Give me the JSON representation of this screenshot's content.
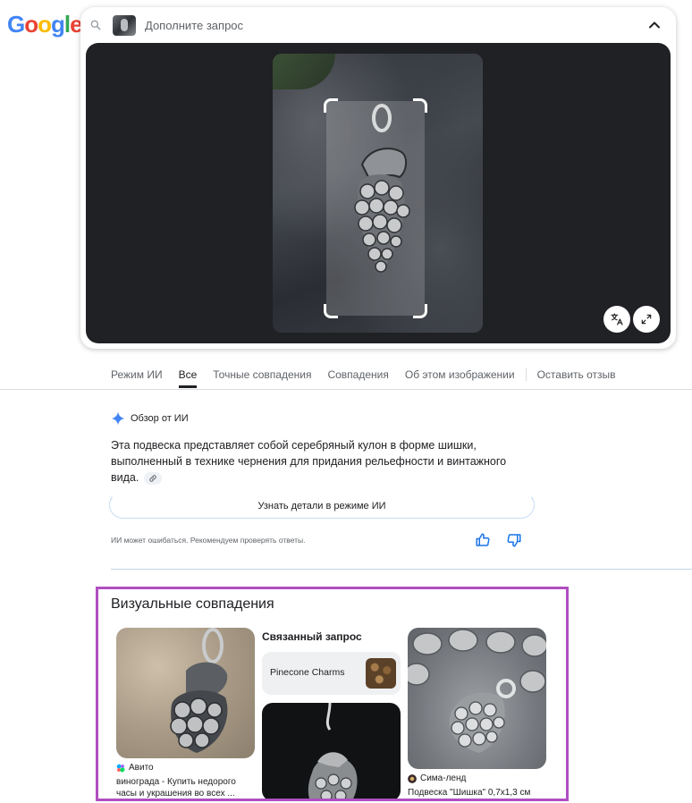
{
  "logo": {
    "letters": [
      "G",
      "o",
      "o",
      "g",
      "l",
      "e"
    ]
  },
  "search": {
    "placeholder": "Дополните запрос"
  },
  "tabs": [
    {
      "label": "Режим ИИ"
    },
    {
      "label": "Все"
    },
    {
      "label": "Точные совпадения"
    },
    {
      "label": "Совпадения"
    },
    {
      "label": "Об этом изображении"
    },
    {
      "label": "Оставить отзыв"
    }
  ],
  "ai_overview": {
    "header": "Обзор от ИИ",
    "text": "Эта подвеска представляет собой серебряный кулон в форме шишки, выполненный в технике чернения для придания рельефности и винтажного вида.",
    "more_button": "Узнать детали в режиме ИИ",
    "disclaimer": "ИИ может ошибаться. Рекомендуем проверять ответы."
  },
  "visual_matches": {
    "title": "Визуальные совпадения",
    "related_title": "Связанный запрос",
    "related_query": "Pinecone Charms",
    "results": [
      {
        "source": "Авито",
        "desc_line1": "винограда - Купить недорого",
        "desc_line2": "часы и украшения во всех ..."
      },
      {
        "source": "Сима-ленд",
        "desc_line1": "Подвеска \"Шишка\" 0,7х1,3 см"
      }
    ]
  },
  "colors": {
    "google_blue": "#4285f4",
    "google_red": "#ea4335",
    "google_yellow": "#fbbc05",
    "google_green": "#34a853",
    "highlight_border": "#b04ec0",
    "lens_background": "#202124"
  }
}
